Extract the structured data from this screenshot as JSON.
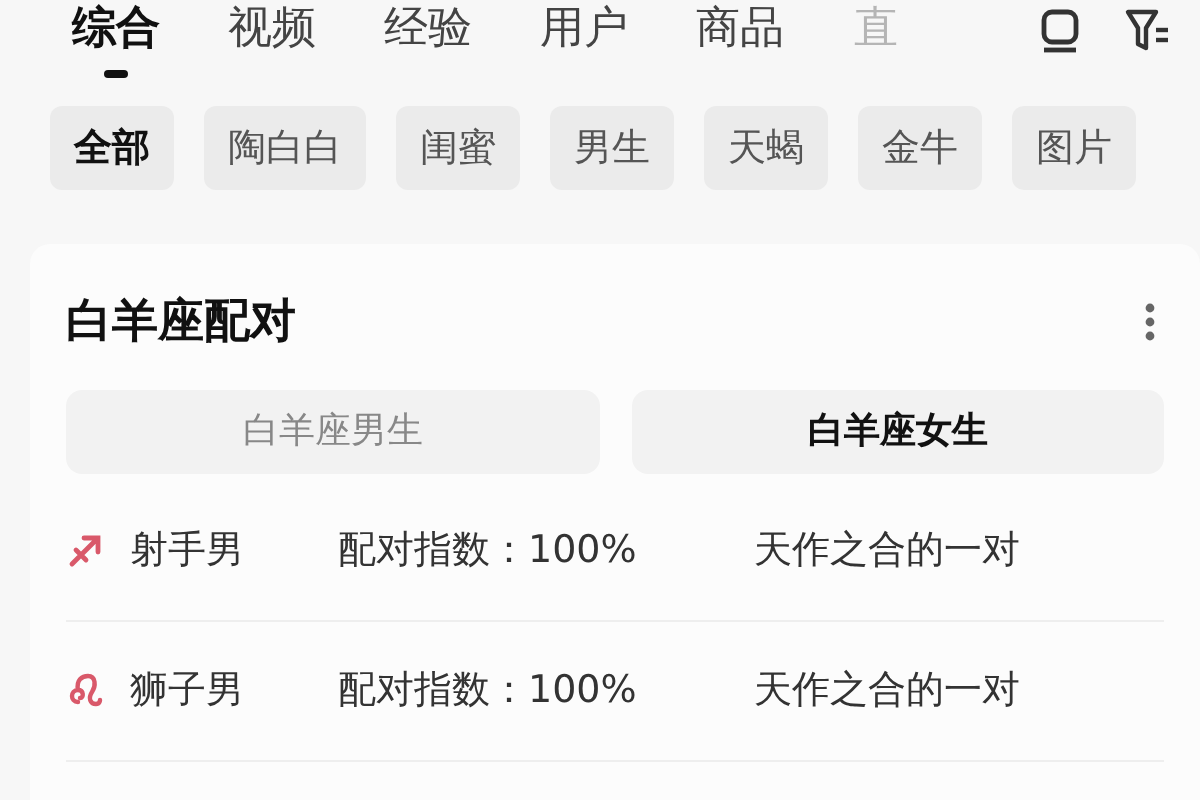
{
  "tabs": [
    {
      "label": "综合",
      "selected": true
    },
    {
      "label": "视频",
      "selected": false
    },
    {
      "label": "经验",
      "selected": false
    },
    {
      "label": "用户",
      "selected": false
    },
    {
      "label": "商品",
      "selected": false
    },
    {
      "label": "直",
      "selected": false
    }
  ],
  "chips": [
    {
      "label": "全部",
      "selected": true
    },
    {
      "label": "陶白白",
      "selected": false
    },
    {
      "label": "闺蜜",
      "selected": false
    },
    {
      "label": "男生",
      "selected": false
    },
    {
      "label": "天蝎",
      "selected": false
    },
    {
      "label": "金牛",
      "selected": false
    },
    {
      "label": "图片",
      "selected": false
    }
  ],
  "card": {
    "title": "白羊座配对",
    "segments": [
      {
        "label": "白羊座男生",
        "selected": false
      },
      {
        "label": "白羊座女生",
        "selected": true
      }
    ],
    "rows": [
      {
        "kind": "sagittarius",
        "name": "射手男",
        "score": "配对指数：100%",
        "verdict": "天作之合的一对"
      },
      {
        "kind": "leo",
        "name": "狮子男",
        "score": "配对指数：100%",
        "verdict": "天作之合的一对"
      }
    ]
  }
}
